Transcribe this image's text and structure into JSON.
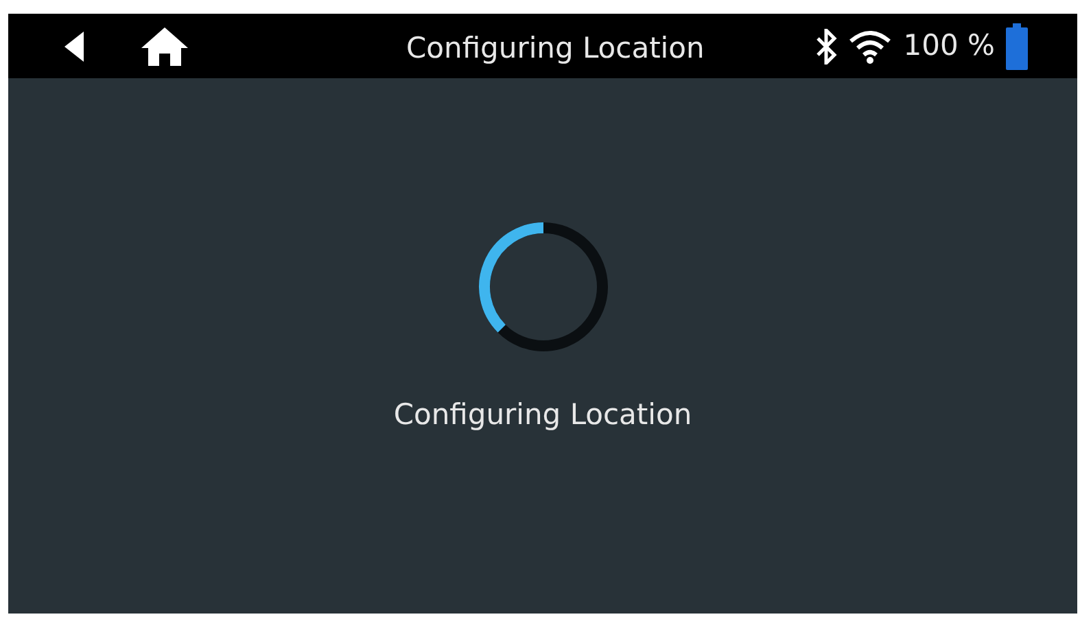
{
  "top_bar": {
    "title": "Configuring Location",
    "battery_text": "100 %"
  },
  "body": {
    "message": "Configuring Location"
  }
}
